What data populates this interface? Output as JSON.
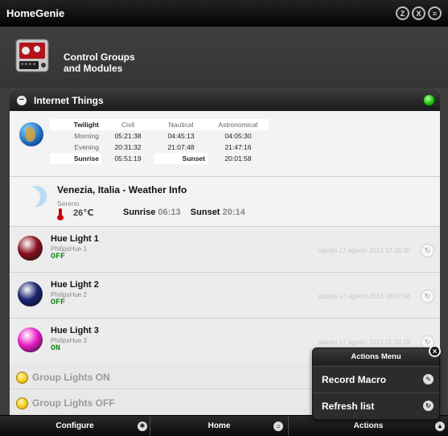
{
  "app": {
    "title": "HomeGenie"
  },
  "header_icons": [
    {
      "name": "z-icon",
      "glyph": "Z"
    },
    {
      "name": "x10-icon",
      "glyph": "X"
    },
    {
      "name": "filter-icon",
      "glyph": "≡"
    }
  ],
  "page": {
    "title_line1": "Control Groups",
    "title_line2": "and Modules"
  },
  "group": {
    "title": "Internet Things",
    "status_color": "#22c20f"
  },
  "twilight": {
    "header": [
      "Twilight",
      "Civil",
      "Nautical",
      "Astronomical"
    ],
    "rows": [
      {
        "label": "Morning",
        "civil": "05:21:38",
        "nautical": "04:45:13",
        "astronomical": "04:05:30"
      },
      {
        "label": "Evening",
        "civil": "20:31:32",
        "nautical": "21:07:48",
        "astronomical": "21:47:16"
      }
    ],
    "sunrise_label": "Sunrise",
    "sunrise": "05:51:19",
    "sunset_label": "Sunset",
    "sunset": "20:01:58"
  },
  "weather": {
    "title": "Venezia, Italia - Weather Info",
    "description": "Sereno",
    "temperature": "26℃",
    "sunrise_label": "Sunrise",
    "sunrise": "06:13",
    "sunset_label": "Sunset",
    "sunset": "20:14"
  },
  "modules": [
    {
      "name": "Hue Light 1",
      "type": "PhilipsHue 1",
      "state": "OFF",
      "date": "sabato 17 agosto 2013 17:38:30",
      "color": "#8a1020"
    },
    {
      "name": "Hue Light 2",
      "type": "PhilipsHue 2",
      "state": "OFF",
      "date": "sabato 17 agosto 2013 16:07:08",
      "color": "#1a2370"
    },
    {
      "name": "Hue Light 3",
      "type": "PhilipsHue 3",
      "state": "ON",
      "date": "sabato 17 agosto 2013 21:00:18",
      "color": "#e81cc8"
    }
  ],
  "groups_lights": [
    {
      "label": "Group Lights ON"
    },
    {
      "label": "Group Lights OFF"
    }
  ],
  "footer": {
    "configure": "Configure",
    "home": "Home",
    "actions": "Actions"
  },
  "actions_menu": {
    "title": "Actions Menu",
    "items": [
      {
        "label": "Record Macro",
        "icon": "pencil-icon"
      },
      {
        "label": "Refresh list",
        "icon": "refresh-icon"
      }
    ]
  }
}
